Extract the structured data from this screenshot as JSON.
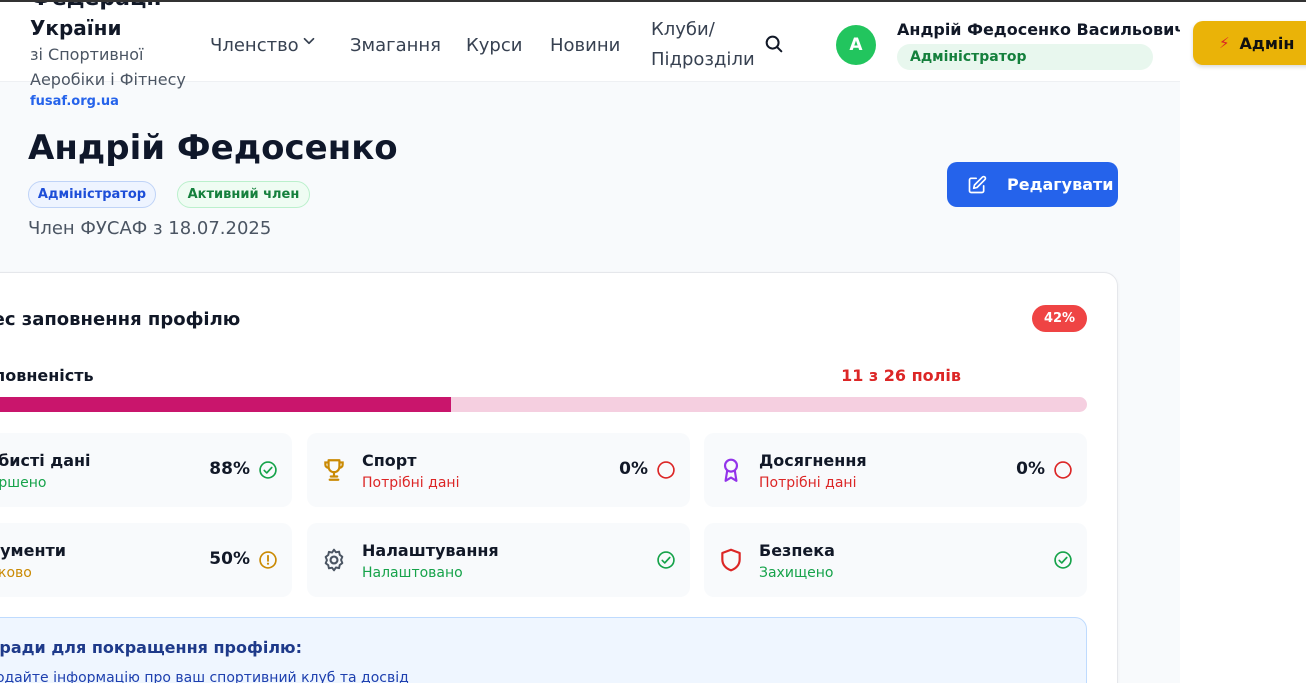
{
  "header": {
    "brand_title": "України",
    "brand_clipped": "Федерації",
    "brand_sub1": "зі Спортивної",
    "brand_sub2": "Аеробіки і Фітнесу",
    "brand_url": "fusaf.org.ua",
    "nav": [
      {
        "label": "Членство"
      },
      {
        "label": "Змагання"
      },
      {
        "label": "Курси"
      },
      {
        "label": "Новини"
      },
      {
        "label_line1": "Клуби/",
        "label_line2": "Підрозділи"
      }
    ],
    "user": {
      "avatar_letter": "А",
      "name": "Андрій Федосенко Васильович",
      "role": "Адміністратор"
    },
    "admin_button": "Адмін"
  },
  "profile": {
    "name": "Андрій Федосенко",
    "badges": [
      "Адміністратор",
      "Активний член"
    ],
    "member_since": "Член ФУСАФ з 18.07.2025",
    "edit_button": "Редагувати"
  },
  "progress": {
    "title": "Прогрес заповнення профілю",
    "percent_label": "42%",
    "percent": 0.42,
    "fill_label": "Заповненість",
    "fill_count": "11 з 26 полів",
    "sections": [
      {
        "title": "Особисті дані",
        "status": "Завершено",
        "pct": "88%",
        "icon": "user-icon",
        "state": "check"
      },
      {
        "title": "Спорт",
        "status": "Потрібні дані",
        "pct": "0%",
        "icon": "trophy-icon",
        "state": "empty"
      },
      {
        "title": "Досягнення",
        "status": "Потрібні дані",
        "pct": "0%",
        "icon": "award-icon",
        "state": "empty"
      },
      {
        "title": "Документи",
        "status": "Частково",
        "pct": "50%",
        "icon": "file-icon",
        "state": "warning"
      },
      {
        "title": "Налаштування",
        "status": "Налаштовано",
        "pct": "",
        "icon": "gear-icon",
        "state": "check"
      },
      {
        "title": "Безпека",
        "status": "Захищено",
        "pct": "",
        "icon": "shield-icon",
        "state": "check"
      }
    ],
    "colors": {
      "fill": "#c9156c",
      "track": "#f5cfe0",
      "ok": "#16a34a",
      "bad": "#dc2626",
      "warn": "#ca8a04"
    }
  },
  "tips": {
    "title": "Поради для покращення профілю:",
    "items": [
      "Додайте інформацію про ваш спортивний клуб та досвід"
    ]
  }
}
